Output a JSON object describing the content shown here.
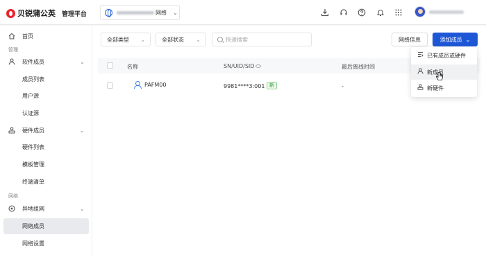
{
  "header": {
    "logo_text": "贝锐蒲公英",
    "platform_label": "管理平台",
    "network_suffix": "网络",
    "icons": [
      "download-icon",
      "headset-icon",
      "help-icon",
      "bell-icon",
      "apps-grid-icon"
    ]
  },
  "sidebar": {
    "home": "首页",
    "section_manage": "管理",
    "software_members": "软件成员",
    "member_list": "成员列表",
    "user_source": "用户源",
    "auth_source": "认证源",
    "hardware_members": "硬件成员",
    "hardware_list": "硬件列表",
    "template_manage": "模板管理",
    "terminal_list": "终端清单",
    "section_network": "网络",
    "remote_network": "异地组网",
    "network_members": "网络成员",
    "network_settings": "网络设置"
  },
  "filters": {
    "type": "全部类型",
    "status": "全部状态",
    "search_placeholder": "快速搜索"
  },
  "toolbar": {
    "network_info": "网络信息",
    "add_member": "添加成员"
  },
  "table": {
    "columns": [
      "名称",
      "SN/UID/SID",
      "最后离线时间"
    ],
    "rows": [
      {
        "name": "PAFM00",
        "sn": "9981****3:001",
        "tag": "新",
        "last_offline": "-"
      }
    ]
  },
  "add_menu": {
    "items": [
      "已有成员或硬件",
      "新成员",
      "新硬件"
    ]
  },
  "colors": {
    "primary": "#1e57d6",
    "brand": "#e5262f"
  }
}
